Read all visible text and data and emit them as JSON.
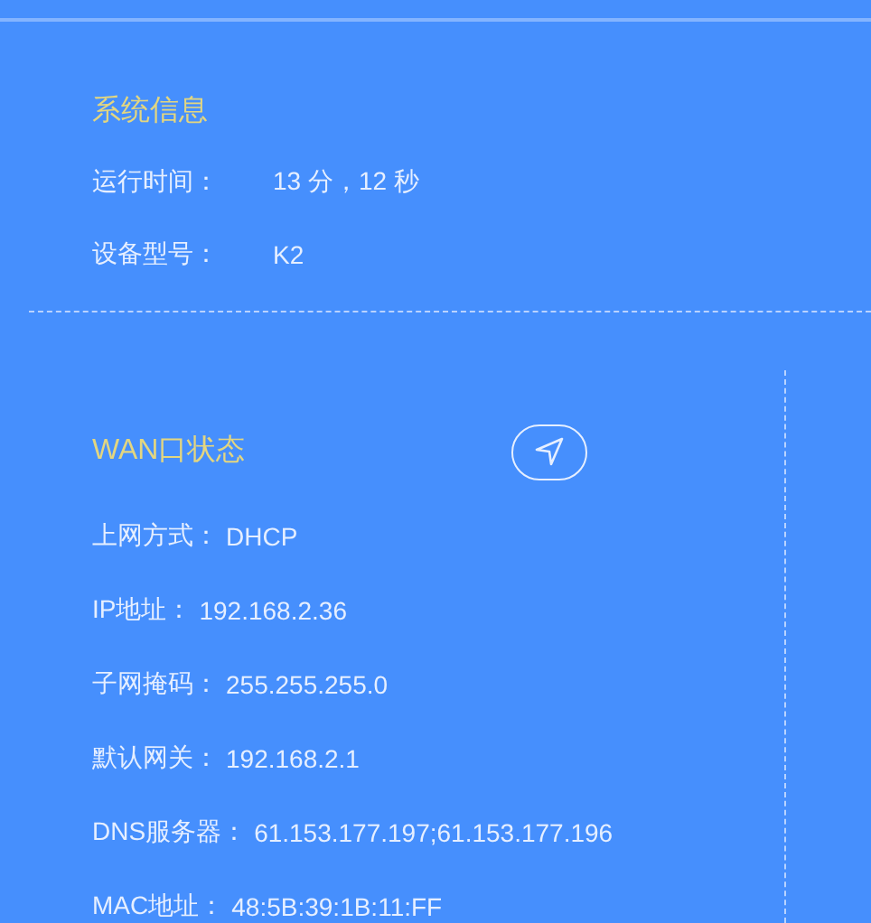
{
  "system_info": {
    "title": "系统信息",
    "kind": "aligned",
    "rows": [
      {
        "label": "运行时间：",
        "value": "13 分，12 秒"
      },
      {
        "label": "设备型号：",
        "value": "K2"
      }
    ]
  },
  "wan_status": {
    "title": "WAN口状态",
    "kind": "inline",
    "rows": [
      {
        "label": "上网方式：",
        "value": "DHCP"
      },
      {
        "label": "IP地址：",
        "value": "192.168.2.36"
      },
      {
        "label": "子网掩码：",
        "value": "255.255.255.0"
      },
      {
        "label": "默认网关：",
        "value": "192.168.2.1"
      },
      {
        "label": "DNS服务器：",
        "value": "61.153.177.197;61.153.177.196"
      },
      {
        "label": "MAC地址：",
        "value": "48:5B:39:1B:11:FF"
      }
    ]
  }
}
